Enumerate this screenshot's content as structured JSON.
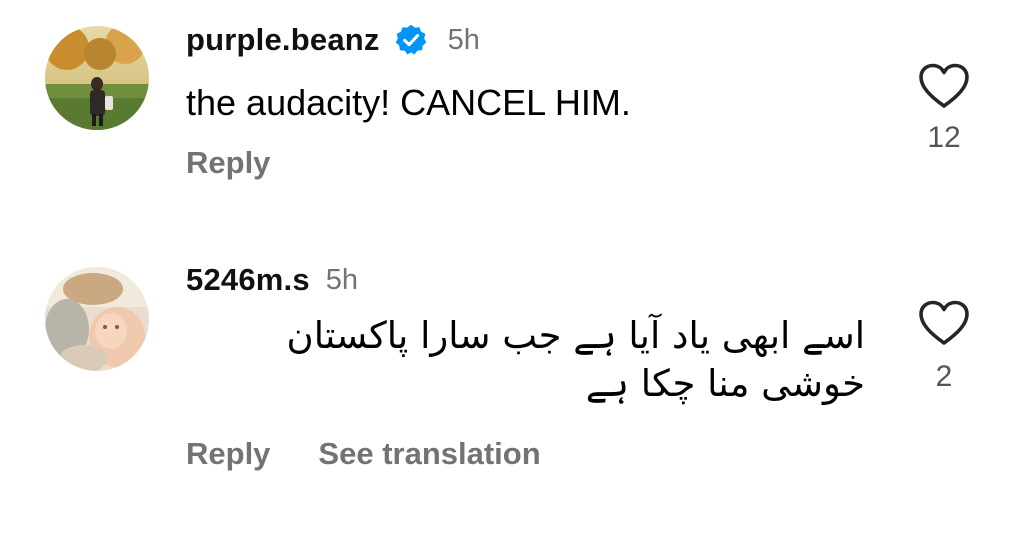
{
  "comments": [
    {
      "username": "purple.beanz",
      "verified": true,
      "time": "5h",
      "text": "the audacity! CANCEL HIM.",
      "like_count": "12",
      "actions": {
        "reply": "Reply"
      },
      "icons": {
        "verified": "verified-badge-icon",
        "like": "heart-icon"
      }
    },
    {
      "username": "5246m.s",
      "verified": false,
      "time": "5h",
      "text": "اسے ابھی یاد آیا ہے جب سارا پاکستان خوشی منا چکا ہے",
      "like_count": "2",
      "actions": {
        "reply": "Reply",
        "see_translation": "See translation"
      },
      "icons": {
        "like": "heart-icon"
      }
    }
  ],
  "colors": {
    "verified_badge": "#0095f6",
    "secondary_text": "#737373",
    "primary_text": "#000000"
  }
}
